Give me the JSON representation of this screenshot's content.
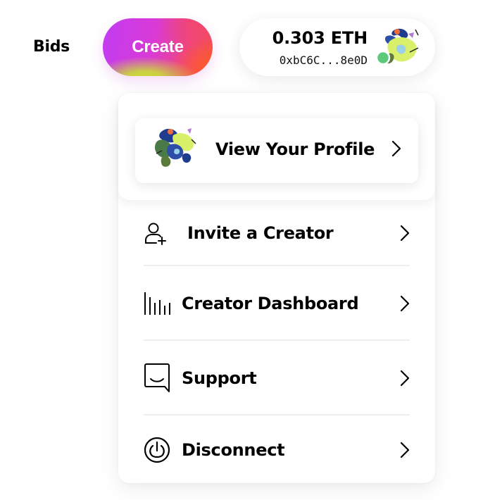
{
  "header": {
    "bids_label": "Bids",
    "create_label": "Create"
  },
  "wallet": {
    "balance": "0.303 ETH",
    "address": "0xbC6C...8e0D",
    "avatar_icon": "generative-art-avatar",
    "status_color": "#5cc97a"
  },
  "menu": {
    "profile": {
      "label": "View Your Profile",
      "avatar_icon": "generative-art-avatar"
    },
    "items": [
      {
        "label": "Invite a Creator",
        "icon": "user-plus-icon"
      },
      {
        "label": "Creator Dashboard",
        "icon": "bar-chart-icon"
      },
      {
        "label": "Support",
        "icon": "chat-bubble-icon"
      },
      {
        "label": "Disconnect",
        "icon": "power-icon"
      }
    ]
  },
  "colors": {
    "create_gradient": [
      "#c13cf2",
      "#ee4583",
      "#f4553e",
      "#c9e62d"
    ],
    "text": "#000000",
    "divider": "#eeeeee"
  }
}
